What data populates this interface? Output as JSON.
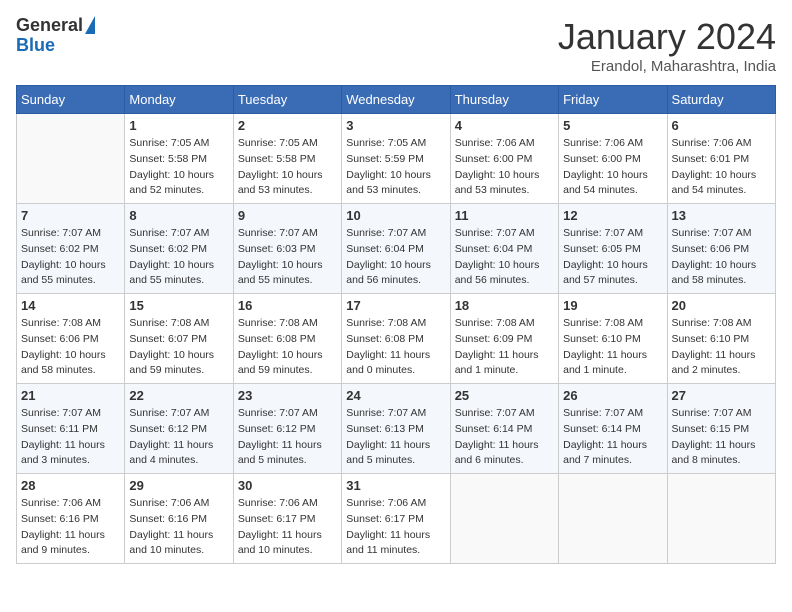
{
  "header": {
    "logo_general": "General",
    "logo_blue": "Blue",
    "month_title": "January 2024",
    "location": "Erandol, Maharashtra, India"
  },
  "days_of_week": [
    "Sunday",
    "Monday",
    "Tuesday",
    "Wednesday",
    "Thursday",
    "Friday",
    "Saturday"
  ],
  "weeks": [
    [
      {
        "day": "",
        "sunrise": "",
        "sunset": "",
        "daylight": "",
        "empty": true
      },
      {
        "day": "1",
        "sunrise": "Sunrise: 7:05 AM",
        "sunset": "Sunset: 5:58 PM",
        "daylight": "Daylight: 10 hours and 52 minutes."
      },
      {
        "day": "2",
        "sunrise": "Sunrise: 7:05 AM",
        "sunset": "Sunset: 5:58 PM",
        "daylight": "Daylight: 10 hours and 53 minutes."
      },
      {
        "day": "3",
        "sunrise": "Sunrise: 7:05 AM",
        "sunset": "Sunset: 5:59 PM",
        "daylight": "Daylight: 10 hours and 53 minutes."
      },
      {
        "day": "4",
        "sunrise": "Sunrise: 7:06 AM",
        "sunset": "Sunset: 6:00 PM",
        "daylight": "Daylight: 10 hours and 53 minutes."
      },
      {
        "day": "5",
        "sunrise": "Sunrise: 7:06 AM",
        "sunset": "Sunset: 6:00 PM",
        "daylight": "Daylight: 10 hours and 54 minutes."
      },
      {
        "day": "6",
        "sunrise": "Sunrise: 7:06 AM",
        "sunset": "Sunset: 6:01 PM",
        "daylight": "Daylight: 10 hours and 54 minutes."
      }
    ],
    [
      {
        "day": "7",
        "sunrise": "Sunrise: 7:07 AM",
        "sunset": "Sunset: 6:02 PM",
        "daylight": "Daylight: 10 hours and 55 minutes."
      },
      {
        "day": "8",
        "sunrise": "Sunrise: 7:07 AM",
        "sunset": "Sunset: 6:02 PM",
        "daylight": "Daylight: 10 hours and 55 minutes."
      },
      {
        "day": "9",
        "sunrise": "Sunrise: 7:07 AM",
        "sunset": "Sunset: 6:03 PM",
        "daylight": "Daylight: 10 hours and 55 minutes."
      },
      {
        "day": "10",
        "sunrise": "Sunrise: 7:07 AM",
        "sunset": "Sunset: 6:04 PM",
        "daylight": "Daylight: 10 hours and 56 minutes."
      },
      {
        "day": "11",
        "sunrise": "Sunrise: 7:07 AM",
        "sunset": "Sunset: 6:04 PM",
        "daylight": "Daylight: 10 hours and 56 minutes."
      },
      {
        "day": "12",
        "sunrise": "Sunrise: 7:07 AM",
        "sunset": "Sunset: 6:05 PM",
        "daylight": "Daylight: 10 hours and 57 minutes."
      },
      {
        "day": "13",
        "sunrise": "Sunrise: 7:07 AM",
        "sunset": "Sunset: 6:06 PM",
        "daylight": "Daylight: 10 hours and 58 minutes."
      }
    ],
    [
      {
        "day": "14",
        "sunrise": "Sunrise: 7:08 AM",
        "sunset": "Sunset: 6:06 PM",
        "daylight": "Daylight: 10 hours and 58 minutes."
      },
      {
        "day": "15",
        "sunrise": "Sunrise: 7:08 AM",
        "sunset": "Sunset: 6:07 PM",
        "daylight": "Daylight: 10 hours and 59 minutes."
      },
      {
        "day": "16",
        "sunrise": "Sunrise: 7:08 AM",
        "sunset": "Sunset: 6:08 PM",
        "daylight": "Daylight: 10 hours and 59 minutes."
      },
      {
        "day": "17",
        "sunrise": "Sunrise: 7:08 AM",
        "sunset": "Sunset: 6:08 PM",
        "daylight": "Daylight: 11 hours and 0 minutes."
      },
      {
        "day": "18",
        "sunrise": "Sunrise: 7:08 AM",
        "sunset": "Sunset: 6:09 PM",
        "daylight": "Daylight: 11 hours and 1 minute."
      },
      {
        "day": "19",
        "sunrise": "Sunrise: 7:08 AM",
        "sunset": "Sunset: 6:10 PM",
        "daylight": "Daylight: 11 hours and 1 minute."
      },
      {
        "day": "20",
        "sunrise": "Sunrise: 7:08 AM",
        "sunset": "Sunset: 6:10 PM",
        "daylight": "Daylight: 11 hours and 2 minutes."
      }
    ],
    [
      {
        "day": "21",
        "sunrise": "Sunrise: 7:07 AM",
        "sunset": "Sunset: 6:11 PM",
        "daylight": "Daylight: 11 hours and 3 minutes."
      },
      {
        "day": "22",
        "sunrise": "Sunrise: 7:07 AM",
        "sunset": "Sunset: 6:12 PM",
        "daylight": "Daylight: 11 hours and 4 minutes."
      },
      {
        "day": "23",
        "sunrise": "Sunrise: 7:07 AM",
        "sunset": "Sunset: 6:12 PM",
        "daylight": "Daylight: 11 hours and 5 minutes."
      },
      {
        "day": "24",
        "sunrise": "Sunrise: 7:07 AM",
        "sunset": "Sunset: 6:13 PM",
        "daylight": "Daylight: 11 hours and 5 minutes."
      },
      {
        "day": "25",
        "sunrise": "Sunrise: 7:07 AM",
        "sunset": "Sunset: 6:14 PM",
        "daylight": "Daylight: 11 hours and 6 minutes."
      },
      {
        "day": "26",
        "sunrise": "Sunrise: 7:07 AM",
        "sunset": "Sunset: 6:14 PM",
        "daylight": "Daylight: 11 hours and 7 minutes."
      },
      {
        "day": "27",
        "sunrise": "Sunrise: 7:07 AM",
        "sunset": "Sunset: 6:15 PM",
        "daylight": "Daylight: 11 hours and 8 minutes."
      }
    ],
    [
      {
        "day": "28",
        "sunrise": "Sunrise: 7:06 AM",
        "sunset": "Sunset: 6:16 PM",
        "daylight": "Daylight: 11 hours and 9 minutes."
      },
      {
        "day": "29",
        "sunrise": "Sunrise: 7:06 AM",
        "sunset": "Sunset: 6:16 PM",
        "daylight": "Daylight: 11 hours and 10 minutes."
      },
      {
        "day": "30",
        "sunrise": "Sunrise: 7:06 AM",
        "sunset": "Sunset: 6:17 PM",
        "daylight": "Daylight: 11 hours and 10 minutes."
      },
      {
        "day": "31",
        "sunrise": "Sunrise: 7:06 AM",
        "sunset": "Sunset: 6:17 PM",
        "daylight": "Daylight: 11 hours and 11 minutes."
      },
      {
        "day": "",
        "sunrise": "",
        "sunset": "",
        "daylight": "",
        "empty": true
      },
      {
        "day": "",
        "sunrise": "",
        "sunset": "",
        "daylight": "",
        "empty": true
      },
      {
        "day": "",
        "sunrise": "",
        "sunset": "",
        "daylight": "",
        "empty": true
      }
    ]
  ]
}
